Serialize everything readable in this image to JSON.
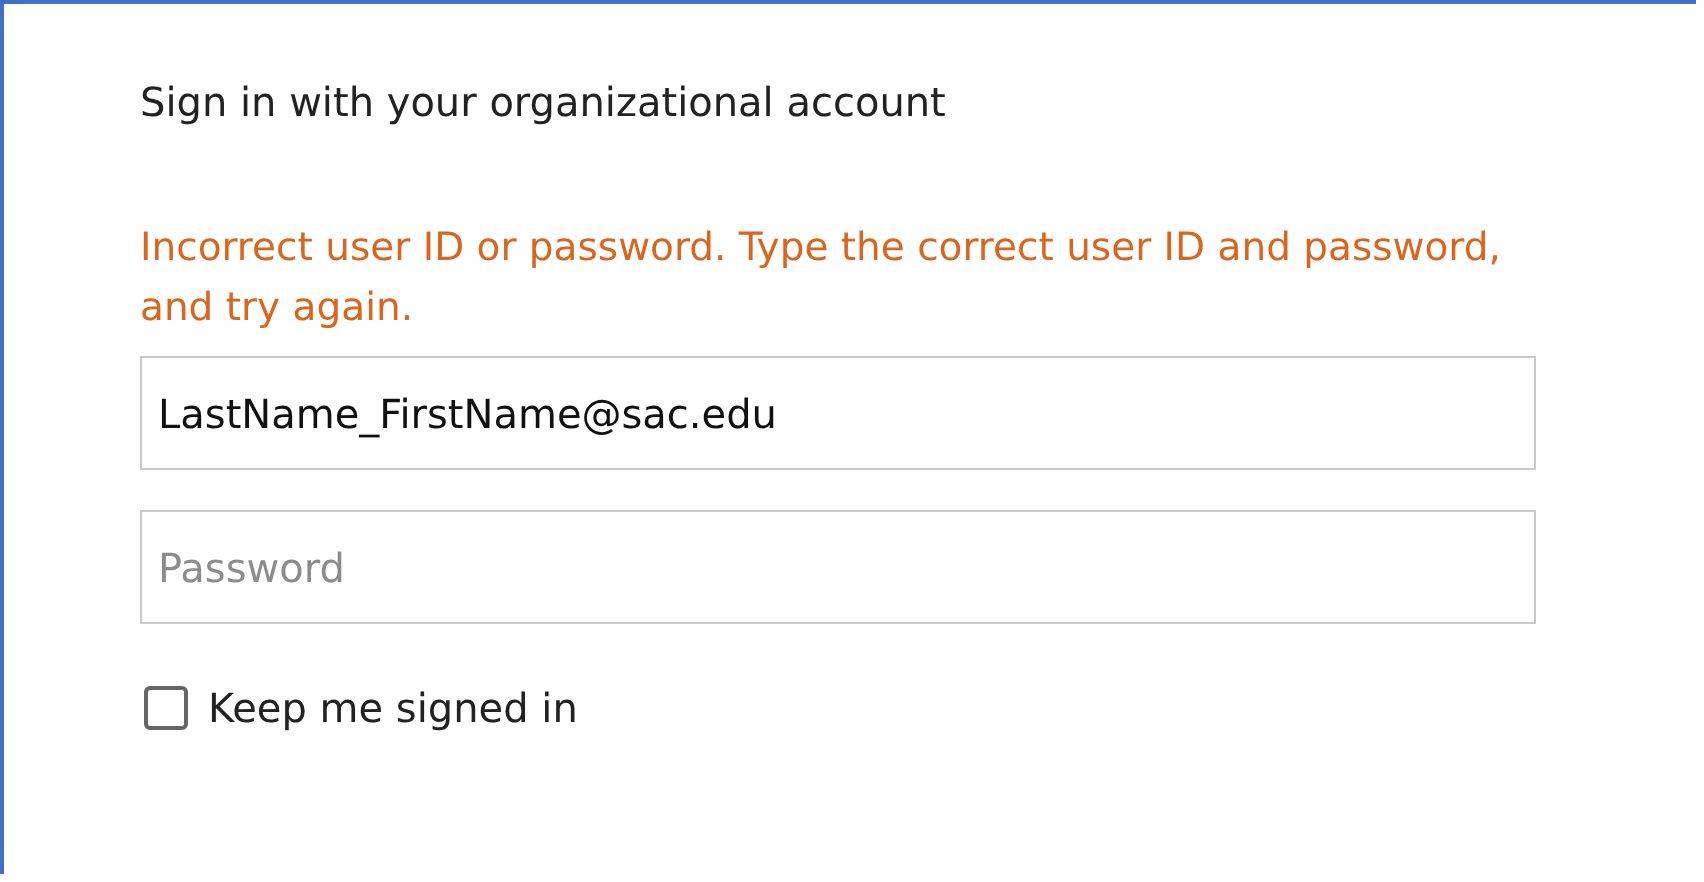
{
  "heading": "Sign in with your organizational account",
  "error": "Incorrect user ID or password. Type the correct user ID and password, and try again.",
  "fields": [
    {
      "kind": "email",
      "value": "LastName_FirstName@sac.edu"
    },
    {
      "kind": "password",
      "placeholder": "Password"
    }
  ],
  "keep_signed_in": {
    "label": "Keep me signed in",
    "checked": false
  }
}
